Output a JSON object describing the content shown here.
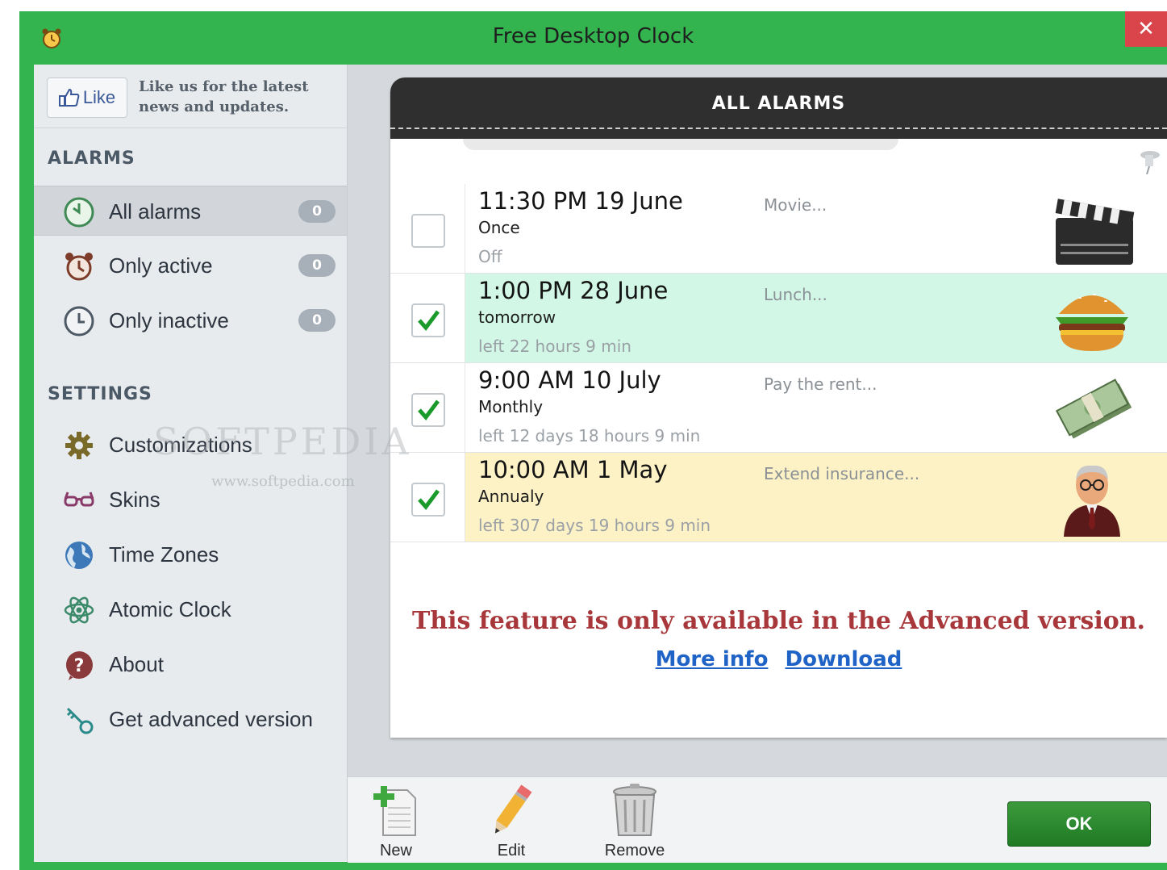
{
  "window": {
    "title": "Free Desktop Clock",
    "close_glyph": "✕"
  },
  "sidebar": {
    "like_label": "Like",
    "like_text": "Like us for the latest news and updates.",
    "alarms_heading": "ALARMS",
    "alarm_filters": [
      {
        "label": "All alarms",
        "count": "0",
        "icon": "clock-icon",
        "selected": true
      },
      {
        "label": "Only active",
        "count": "0",
        "icon": "alarm-clock-icon",
        "selected": false
      },
      {
        "label": "Only inactive",
        "count": "0",
        "icon": "clock-outline-icon",
        "selected": false
      }
    ],
    "settings_heading": "SETTINGS",
    "settings_items": [
      {
        "label": "Customizations",
        "icon": "gear-icon"
      },
      {
        "label": "Skins",
        "icon": "glasses-icon"
      },
      {
        "label": "Time Zones",
        "icon": "globe-icon"
      },
      {
        "label": "Atomic Clock",
        "icon": "atom-icon"
      },
      {
        "label": "About",
        "icon": "question-icon"
      },
      {
        "label": "Get advanced version",
        "icon": "key-icon"
      }
    ]
  },
  "watermark": {
    "main": "SOFTPEDIA",
    "sub": "www.softpedia.com"
  },
  "panel": {
    "title": "ALL ALARMS",
    "alarms": [
      {
        "time": "11:30 PM  19 June",
        "repeat": "Once",
        "remaining": "Off",
        "note": "Movie...",
        "checked": false,
        "bg": "#ffffff",
        "picture": "clapperboard-icon"
      },
      {
        "time": "1:00 PM  28 June",
        "repeat": "tomorrow",
        "remaining": "left 22 hours 9 min",
        "note": "Lunch...",
        "checked": true,
        "bg": "#d2f7e6",
        "picture": "burger-icon"
      },
      {
        "time": "9:00 AM  10 July",
        "repeat": "Monthly",
        "remaining": "left 12 days 18 hours 9 min",
        "note": "Pay the rent...",
        "checked": true,
        "bg": "#ffffff",
        "picture": "money-icon"
      },
      {
        "time": "10:00 AM  1 May",
        "repeat": "Annualy",
        "remaining": "left 307 days 19 hours 9 min",
        "note": "Extend insurance...",
        "checked": true,
        "bg": "#fdf2c6",
        "picture": "businessman-icon"
      }
    ],
    "upgrade_message": "This feature is only available in the Advanced version.",
    "more_info": "More info",
    "download": "Download"
  },
  "toolbar": {
    "new_label": "New",
    "edit_label": "Edit",
    "remove_label": "Remove",
    "ok_label": "OK"
  },
  "colors": {
    "window_green": "#33b44f",
    "close_red": "#d9454a",
    "ok_green": "#2a8a2e",
    "link_blue": "#1f63c6",
    "upgrade_red": "#a7373a"
  }
}
